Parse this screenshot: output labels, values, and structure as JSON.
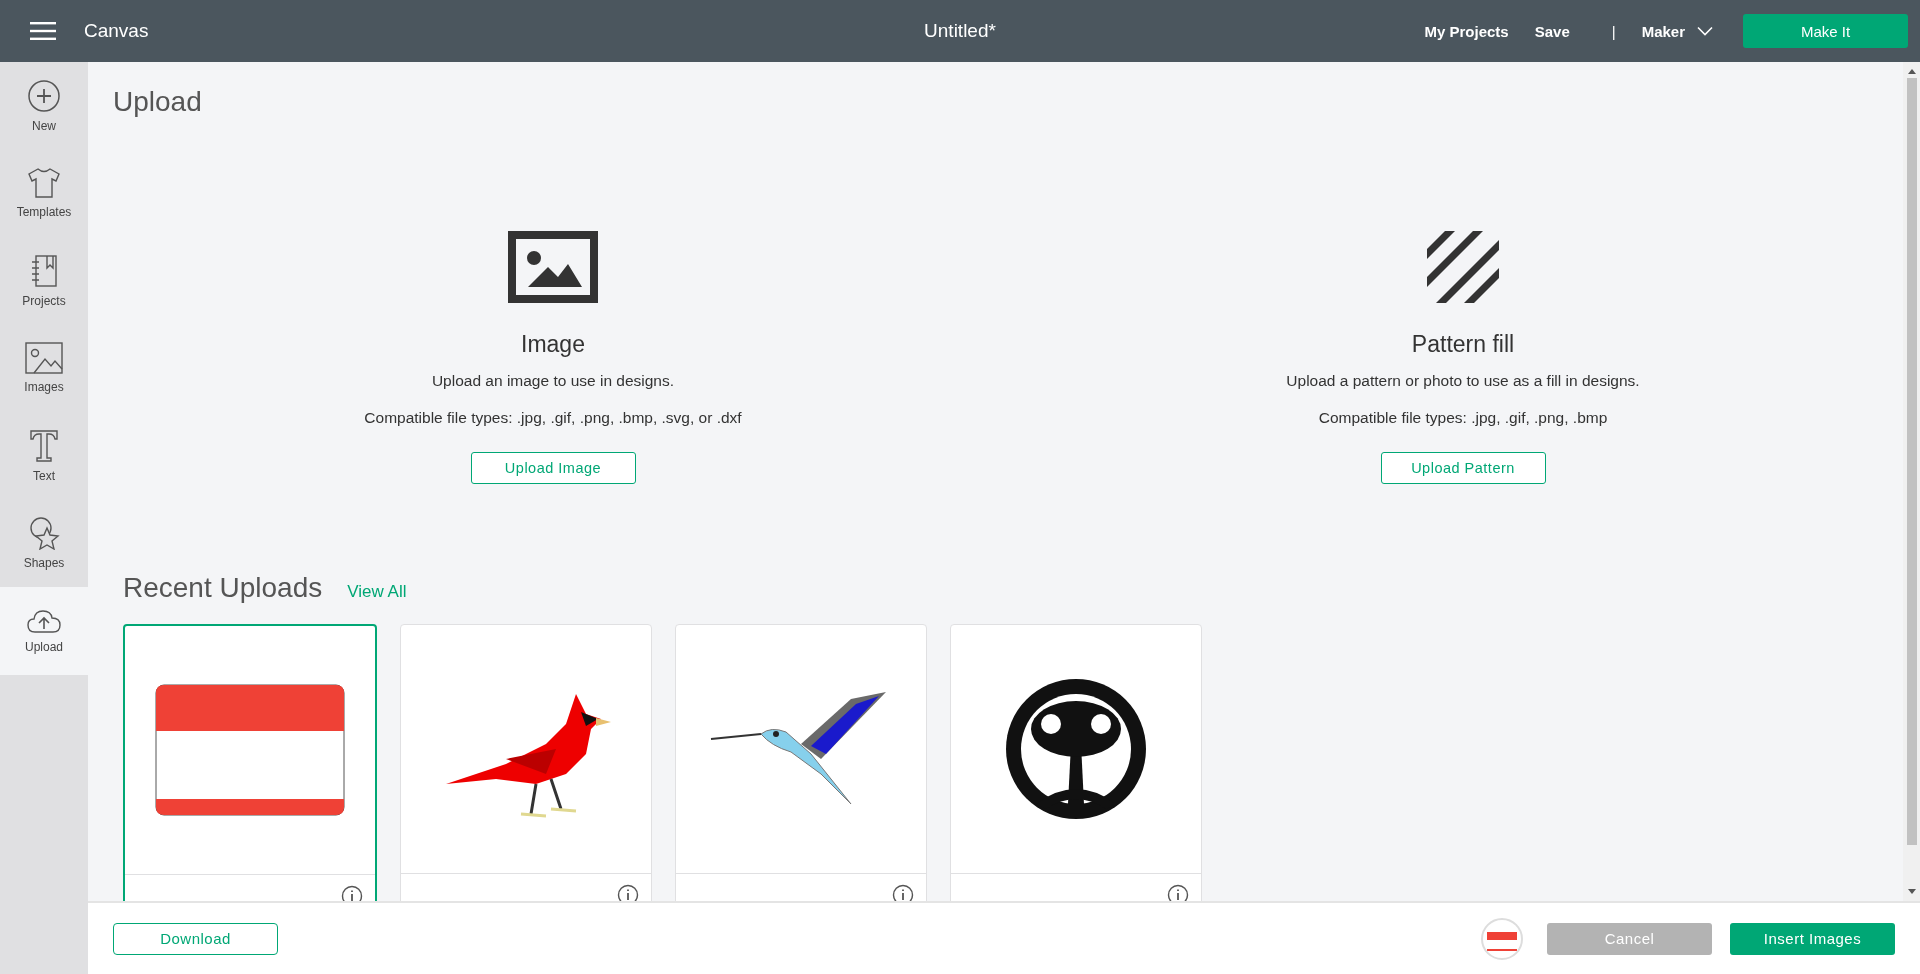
{
  "top_bar": {
    "app_name": "Canvas",
    "title": "Untitled*",
    "links": [
      "My Projects",
      "Save"
    ],
    "separator": "|",
    "machine": "Maker",
    "make_button": "Make It"
  },
  "sidebar": {
    "items": [
      {
        "label": "New",
        "selected": false
      },
      {
        "label": "Templates",
        "selected": false
      },
      {
        "label": "Projects",
        "selected": false
      },
      {
        "label": "Images",
        "selected": false
      },
      {
        "label": "Text",
        "selected": false
      },
      {
        "label": "Shapes",
        "selected": false
      },
      {
        "label": "Upload",
        "selected": true
      }
    ]
  },
  "page_title": "Upload",
  "options": [
    {
      "title": "Image",
      "description": "Upload an image to use in designs.",
      "file_types": "Compatible file types: .jpg, .gif, .png, .bmp, .svg, or .dxf",
      "button": "Upload Image"
    },
    {
      "title": "Pattern fill",
      "description": "Upload a pattern or photo to use as a fill in designs.",
      "file_types": "Compatible file types: .jpg, .gif, .png, .bmp",
      "button": "Upload Pattern"
    }
  ],
  "recent": {
    "title": "Recent Uploads",
    "view_all": "View All",
    "items": [
      {
        "kind": "picture",
        "selected": true
      },
      {
        "kind": "picture",
        "selected": false
      },
      {
        "kind": "picture",
        "selected": false
      },
      {
        "kind": "picture",
        "selected": false
      }
    ]
  },
  "footer": {
    "download": "Download",
    "cancel": "Cancel",
    "insert": "Insert Images"
  }
}
